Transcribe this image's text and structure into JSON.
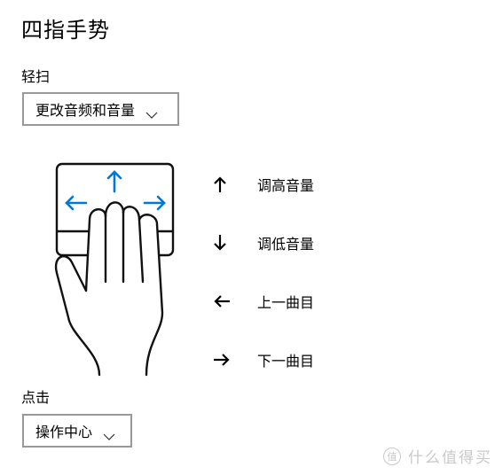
{
  "page": {
    "title": "四指手势"
  },
  "swipe": {
    "label": "轻扫",
    "selected": "更改音频和音量"
  },
  "gestures": [
    {
      "direction_icon": "arrow-up-icon",
      "label": "调高音量"
    },
    {
      "direction_icon": "arrow-down-icon",
      "label": "调低音量"
    },
    {
      "direction_icon": "arrow-left-icon",
      "label": "上一曲目"
    },
    {
      "direction_icon": "arrow-right-icon",
      "label": "下一曲目"
    }
  ],
  "tap": {
    "label": "点击",
    "selected": "操作中心"
  },
  "illustration": {
    "icon": "four-finger-touchpad-hand-icon",
    "accent_color": "#0078D7"
  },
  "watermark": {
    "badge": "值",
    "text": "什么值得买"
  }
}
